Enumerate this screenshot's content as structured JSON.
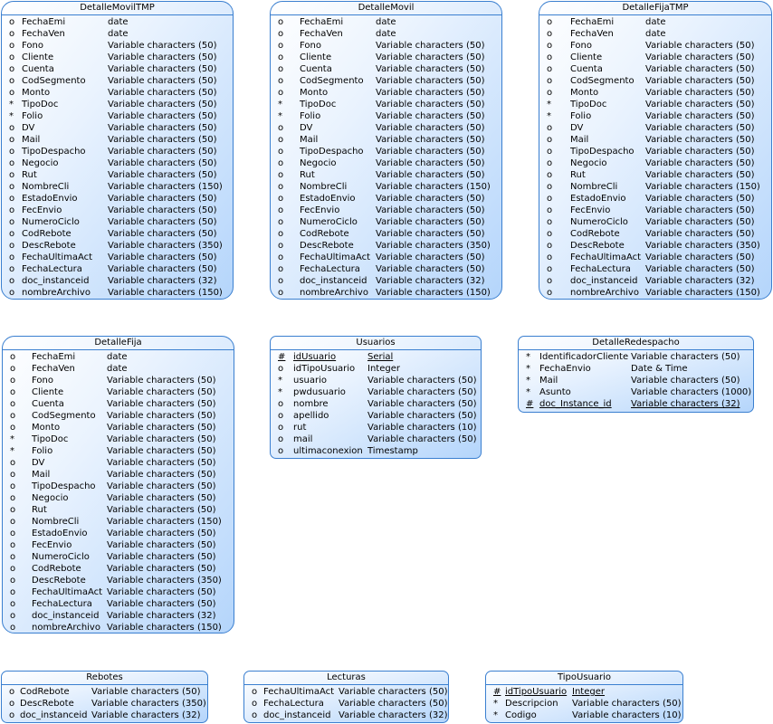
{
  "entities": [
    {
      "name": "DetalleMovilTMP",
      "attrs": [
        [
          "o",
          "FechaEmi",
          "date"
        ],
        [
          "o",
          "FechaVen",
          "date"
        ],
        [
          "o",
          "Fono",
          "Variable characters (50)"
        ],
        [
          "o",
          "Cliente",
          "Variable characters (50)"
        ],
        [
          "o",
          "Cuenta",
          "Variable characters (50)"
        ],
        [
          "o",
          "CodSegmento",
          "Variable characters (50)"
        ],
        [
          "o",
          "Monto",
          "Variable characters (50)"
        ],
        [
          "*",
          "TipoDoc",
          "Variable characters (50)"
        ],
        [
          "*",
          "Folio",
          "Variable characters (50)"
        ],
        [
          "o",
          "DV",
          "Variable characters (50)"
        ],
        [
          "o",
          "Mail",
          "Variable characters (50)"
        ],
        [
          "o",
          "TipoDespacho",
          "Variable characters (50)"
        ],
        [
          "o",
          "Negocio",
          "Variable characters (50)"
        ],
        [
          "o",
          "Rut",
          "Variable characters (50)"
        ],
        [
          "o",
          "NombreCli",
          "Variable characters (150)"
        ],
        [
          "o",
          "EstadoEnvio",
          "Variable characters (50)"
        ],
        [
          "o",
          "FecEnvio",
          "Variable characters (50)"
        ],
        [
          "o",
          "NumeroCiclo",
          "Variable characters (50)"
        ],
        [
          "o",
          "CodRebote",
          "Variable characters (50)"
        ],
        [
          "o",
          "DescRebote",
          "Variable characters (350)"
        ],
        [
          "o",
          "FechaUltimaAct",
          "Variable characters (50)"
        ],
        [
          "o",
          "FechaLectura",
          "Variable characters (50)"
        ],
        [
          "o",
          "doc_instanceid",
          "Variable characters (32)"
        ],
        [
          "o",
          "nombreArchivo",
          "Variable characters (150)"
        ]
      ]
    },
    {
      "name": "DetalleMovil",
      "attrs": [
        [
          "o",
          "FechaEmi",
          "date"
        ],
        [
          "o",
          "FechaVen",
          "date"
        ],
        [
          "o",
          "Fono",
          "Variable characters (50)"
        ],
        [
          "o",
          "Cliente",
          "Variable characters (50)"
        ],
        [
          "o",
          "Cuenta",
          "Variable characters (50)"
        ],
        [
          "o",
          "CodSegmento",
          "Variable characters (50)"
        ],
        [
          "o",
          "Monto",
          "Variable characters (50)"
        ],
        [
          "*",
          "TipoDoc",
          "Variable characters (50)"
        ],
        [
          "*",
          "Folio",
          "Variable characters (50)"
        ],
        [
          "o",
          "DV",
          "Variable characters (50)"
        ],
        [
          "o",
          "Mail",
          "Variable characters (50)"
        ],
        [
          "o",
          "TipoDespacho",
          "Variable characters (50)"
        ],
        [
          "o",
          "Negocio",
          "Variable characters (50)"
        ],
        [
          "o",
          "Rut",
          "Variable characters (50)"
        ],
        [
          "o",
          "NombreCli",
          "Variable characters (150)"
        ],
        [
          "o",
          "EstadoEnvio",
          "Variable characters (50)"
        ],
        [
          "o",
          "FecEnvio",
          "Variable characters (50)"
        ],
        [
          "o",
          "NumeroCiclo",
          "Variable characters (50)"
        ],
        [
          "o",
          "CodRebote",
          "Variable characters (50)"
        ],
        [
          "o",
          "DescRebote",
          "Variable characters (350)"
        ],
        [
          "o",
          "FechaUltimaAct",
          "Variable characters (50)"
        ],
        [
          "o",
          "FechaLectura",
          "Variable characters (50)"
        ],
        [
          "o",
          "doc_instanceid",
          "Variable characters (32)"
        ],
        [
          "o",
          "nombreArchivo",
          "Variable characters (150)"
        ]
      ]
    },
    {
      "name": "DetalleFijaTMP",
      "attrs": [
        [
          "o",
          "FechaEmi",
          "date"
        ],
        [
          "o",
          "FechaVen",
          "date"
        ],
        [
          "o",
          "Fono",
          "Variable characters (50)"
        ],
        [
          "o",
          "Cliente",
          "Variable characters (50)"
        ],
        [
          "o",
          "Cuenta",
          "Variable characters (50)"
        ],
        [
          "o",
          "CodSegmento",
          "Variable characters (50)"
        ],
        [
          "o",
          "Monto",
          "Variable characters (50)"
        ],
        [
          "*",
          "TipoDoc",
          "Variable characters (50)"
        ],
        [
          "*",
          "Folio",
          "Variable characters (50)"
        ],
        [
          "o",
          "DV",
          "Variable characters (50)"
        ],
        [
          "o",
          "Mail",
          "Variable characters (50)"
        ],
        [
          "o",
          "TipoDespacho",
          "Variable characters (50)"
        ],
        [
          "o",
          "Negocio",
          "Variable characters (50)"
        ],
        [
          "o",
          "Rut",
          "Variable characters (50)"
        ],
        [
          "o",
          "NombreCli",
          "Variable characters (150)"
        ],
        [
          "o",
          "EstadoEnvio",
          "Variable characters (50)"
        ],
        [
          "o",
          "FecEnvio",
          "Variable characters (50)"
        ],
        [
          "o",
          "NumeroCiclo",
          "Variable characters (50)"
        ],
        [
          "o",
          "CodRebote",
          "Variable characters (50)"
        ],
        [
          "o",
          "DescRebote",
          "Variable characters (350)"
        ],
        [
          "o",
          "FechaUltimaAct",
          "Variable characters (50)"
        ],
        [
          "o",
          "FechaLectura",
          "Variable characters (50)"
        ],
        [
          "o",
          "doc_instanceid",
          "Variable characters (32)"
        ],
        [
          "o",
          "nombreArchivo",
          "Variable characters (150)"
        ]
      ]
    },
    {
      "name": "DetalleFija",
      "attrs": [
        [
          "o",
          "FechaEmi",
          "date"
        ],
        [
          "o",
          "FechaVen",
          "date"
        ],
        [
          "o",
          "Fono",
          "Variable characters (50)"
        ],
        [
          "o",
          "Cliente",
          "Variable characters (50)"
        ],
        [
          "o",
          "Cuenta",
          "Variable characters (50)"
        ],
        [
          "o",
          "CodSegmento",
          "Variable characters (50)"
        ],
        [
          "o",
          "Monto",
          "Variable characters (50)"
        ],
        [
          "*",
          "TipoDoc",
          "Variable characters (50)"
        ],
        [
          "*",
          "Folio",
          "Variable characters (50)"
        ],
        [
          "o",
          "DV",
          "Variable characters (50)"
        ],
        [
          "o",
          "Mail",
          "Variable characters (50)"
        ],
        [
          "o",
          "TipoDespacho",
          "Variable characters (50)"
        ],
        [
          "o",
          "Negocio",
          "Variable characters (50)"
        ],
        [
          "o",
          "Rut",
          "Variable characters (50)"
        ],
        [
          "o",
          "NombreCli",
          "Variable characters (150)"
        ],
        [
          "o",
          "EstadoEnvio",
          "Variable characters (50)"
        ],
        [
          "o",
          "FecEnvio",
          "Variable characters (50)"
        ],
        [
          "o",
          "NumeroCiclo",
          "Variable characters (50)"
        ],
        [
          "o",
          "CodRebote",
          "Variable characters (50)"
        ],
        [
          "o",
          "DescRebote",
          "Variable characters (350)"
        ],
        [
          "o",
          "FechaUltimaAct",
          "Variable characters (50)"
        ],
        [
          "o",
          "FechaLectura",
          "Variable characters (50)"
        ],
        [
          "o",
          "doc_instanceid",
          "Variable characters (32)"
        ],
        [
          "o",
          "nombreArchivo",
          "Variable characters (150)"
        ]
      ]
    },
    {
      "name": "Usuarios",
      "attrs": [
        [
          "#",
          "idUsuario",
          "Serial"
        ],
        [
          "o",
          "idTipoUsuario",
          "Integer"
        ],
        [
          "*",
          "usuario",
          "Variable characters (50)"
        ],
        [
          "*",
          "pwdusuario",
          "Variable characters (50)"
        ],
        [
          "o",
          "nombre",
          "Variable characters (50)"
        ],
        [
          "o",
          "apellido",
          "Variable characters (50)"
        ],
        [
          "o",
          "rut",
          "Variable characters (10)"
        ],
        [
          "o",
          "mail",
          "Variable characters (50)"
        ],
        [
          "o",
          "ultimaconexion",
          "Timestamp"
        ]
      ]
    },
    {
      "name": "DetalleRedespacho",
      "attrs": [
        [
          "*",
          "IdentificadorCliente",
          "Variable characters (50)"
        ],
        [
          "*",
          "FechaEnvio",
          "Date & Time"
        ],
        [
          "*",
          "Mail",
          "Variable characters (50)"
        ],
        [
          "*",
          "Asunto",
          "Variable characters (1000)"
        ],
        [
          "#",
          "doc_Instance_id",
          "Variable characters (32)"
        ]
      ]
    },
    {
      "name": "Rebotes",
      "attrs": [
        [
          "o",
          "CodRebote",
          "Variable characters (50)"
        ],
        [
          "o",
          "DescRebote",
          "Variable characters (350)"
        ],
        [
          "o",
          "doc_instanceid",
          "Variable characters (32)"
        ]
      ]
    },
    {
      "name": "Lecturas",
      "attrs": [
        [
          "o",
          "FechaUltimaAct",
          "Variable characters (50)"
        ],
        [
          "o",
          "FechaLectura",
          "Variable characters (50)"
        ],
        [
          "o",
          "doc_instanceid",
          "Variable characters (32)"
        ]
      ]
    },
    {
      "name": "TipoUsuario",
      "attrs": [
        [
          "#",
          "idTipoUsuario",
          "Integer"
        ],
        [
          "*",
          "Descripcion",
          "Variable characters (50)"
        ],
        [
          "*",
          "Codigo",
          "Variable characters (10)"
        ]
      ]
    }
  ]
}
